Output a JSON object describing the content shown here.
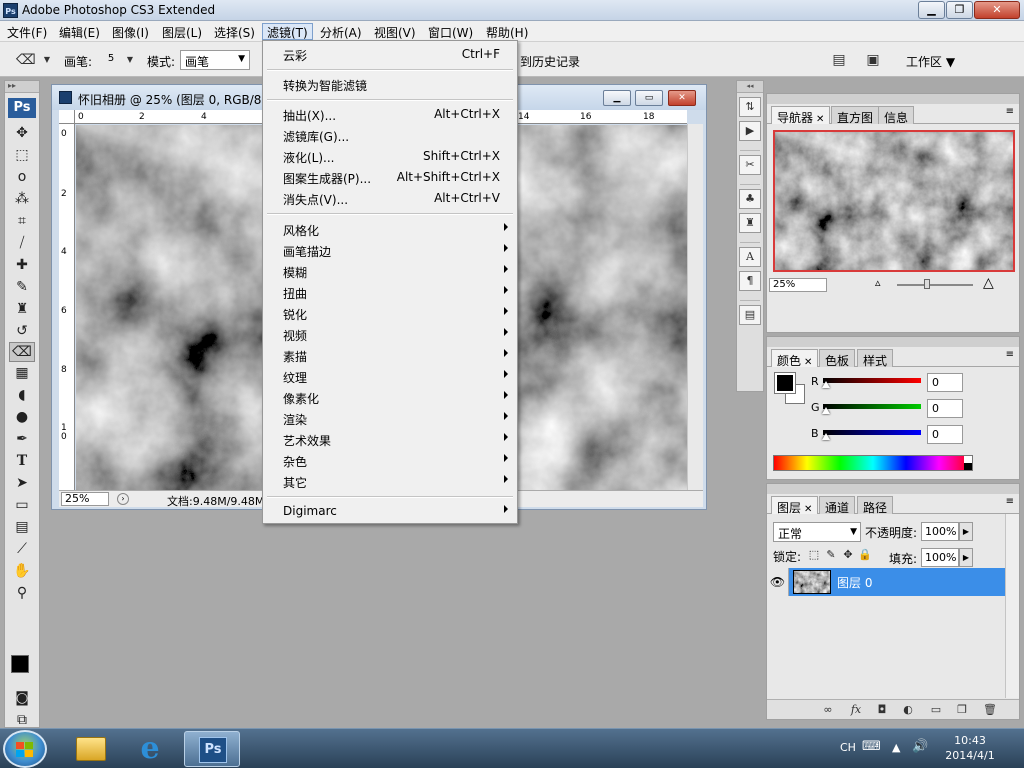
{
  "window": {
    "title": "Adobe Photoshop CS3 Extended",
    "minimize": "▁",
    "maximize": "❐",
    "close": "✕"
  },
  "menubar": [
    "文件(F)",
    "编辑(E)",
    "图像(I)",
    "图层(L)",
    "选择(S)",
    "滤镜(T)",
    "分析(A)",
    "视图(V)",
    "窗口(W)",
    "帮助(H)"
  ],
  "options": {
    "brush_label": "画笔:",
    "brush_size": "5",
    "mode_label": "模式:",
    "mode_value": "画笔",
    "history_text": "到历史记录",
    "workspace_label": "工作区"
  },
  "document": {
    "title": "怀旧相册 @ 25% (图层 0, RGB/8",
    "ruler_h": [
      "0",
      "2",
      "4",
      "14",
      "16",
      "18"
    ],
    "ruler_v": [
      "0",
      "2",
      "4",
      "6",
      "8",
      "1 0"
    ],
    "zoom": "25%",
    "info": "文档:9.48M/9.48M"
  },
  "filter_menu": {
    "items": [
      {
        "label": "云彩",
        "shortcut": "Ctrl+F",
        "sub": false
      },
      {
        "label": "转换为智能滤镜",
        "shortcut": "",
        "sub": false
      },
      {
        "label": "抽出(X)...",
        "shortcut": "Alt+Ctrl+X",
        "sub": false
      },
      {
        "label": "滤镜库(G)...",
        "shortcut": "",
        "sub": false
      },
      {
        "label": "液化(L)...",
        "shortcut": "Shift+Ctrl+X",
        "sub": false
      },
      {
        "label": "图案生成器(P)...",
        "shortcut": "Alt+Shift+Ctrl+X",
        "sub": false
      },
      {
        "label": "消失点(V)...",
        "shortcut": "Alt+Ctrl+V",
        "sub": false
      },
      {
        "label": "风格化",
        "shortcut": "",
        "sub": true
      },
      {
        "label": "画笔描边",
        "shortcut": "",
        "sub": true
      },
      {
        "label": "模糊",
        "shortcut": "",
        "sub": true
      },
      {
        "label": "扭曲",
        "shortcut": "",
        "sub": true
      },
      {
        "label": "锐化",
        "shortcut": "",
        "sub": true
      },
      {
        "label": "视频",
        "shortcut": "",
        "sub": true
      },
      {
        "label": "素描",
        "shortcut": "",
        "sub": true
      },
      {
        "label": "纹理",
        "shortcut": "",
        "sub": true
      },
      {
        "label": "像素化",
        "shortcut": "",
        "sub": true
      },
      {
        "label": "渲染",
        "shortcut": "",
        "sub": true
      },
      {
        "label": "艺术效果",
        "shortcut": "",
        "sub": true
      },
      {
        "label": "杂色",
        "shortcut": "",
        "sub": true
      },
      {
        "label": "其它",
        "shortcut": "",
        "sub": true
      },
      {
        "label": "Digimarc",
        "shortcut": "",
        "sub": true
      }
    ]
  },
  "navigator": {
    "tabs": [
      "导航器",
      "直方图",
      "信息"
    ],
    "zoom": "25%"
  },
  "color": {
    "tabs": [
      "颜色",
      "色板",
      "样式"
    ],
    "r_label": "R",
    "g_label": "G",
    "b_label": "B",
    "r": "0",
    "g": "0",
    "b": "0"
  },
  "layers": {
    "tabs": [
      "图层",
      "通道",
      "路径"
    ],
    "blend_mode": "正常",
    "opacity_label": "不透明度:",
    "opacity": "100%",
    "lock_label": "锁定:",
    "fill_label": "填充:",
    "fill": "100%",
    "layer_name": "图层 0"
  },
  "taskbar": {
    "lang": "CH",
    "time": "10:43",
    "date": "2014/4/1",
    "ps_label": "Ps"
  },
  "tool_icons": [
    "move-icon",
    "marquee-icon",
    "lasso-icon",
    "magic-wand-icon",
    "crop-icon",
    "slice-icon",
    "healing-icon",
    "brush-icon",
    "clone-stamp-icon",
    "history-brush-icon",
    "eraser-icon",
    "gradient-icon",
    "blur-icon",
    "dodge-icon",
    "pen-icon",
    "type-icon",
    "path-select-icon",
    "shape-icon",
    "notes-icon",
    "eyedropper-icon",
    "hand-icon",
    "zoom-icon"
  ]
}
